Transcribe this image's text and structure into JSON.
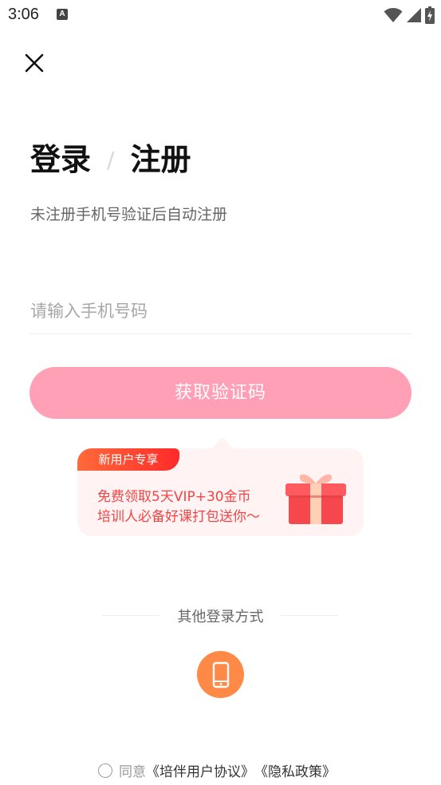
{
  "status_bar": {
    "time": "3:06",
    "notification_icon_letter": "A",
    "icons": [
      "wifi-icon",
      "signal-icon",
      "battery-charging-icon"
    ]
  },
  "header": {
    "close_icon": "close-icon"
  },
  "title": {
    "login": "登录",
    "separator": "/",
    "register": "注册"
  },
  "subtitle": "未注册手机号验证后自动注册",
  "phone_field": {
    "value": "",
    "placeholder": "请输入手机号码"
  },
  "get_code_button": {
    "label": "获取验证码",
    "color": "#ffa0b7"
  },
  "promo": {
    "badge": "新用户专享",
    "line1": "免费领取5天VIP+30金币",
    "line2": "培训人必备好课打包送你～",
    "text_color": "#f34445",
    "background": "#fff3f3",
    "icon": "gift-icon"
  },
  "other_login": {
    "label": "其他登录方式",
    "phone_method_icon": "phone-icon",
    "phone_method_color": "#ff8947"
  },
  "agreement": {
    "prefix": "同意",
    "user_agreement": "《培伴用户协议》",
    "privacy_policy": "《隐私政策》",
    "checked": false
  }
}
